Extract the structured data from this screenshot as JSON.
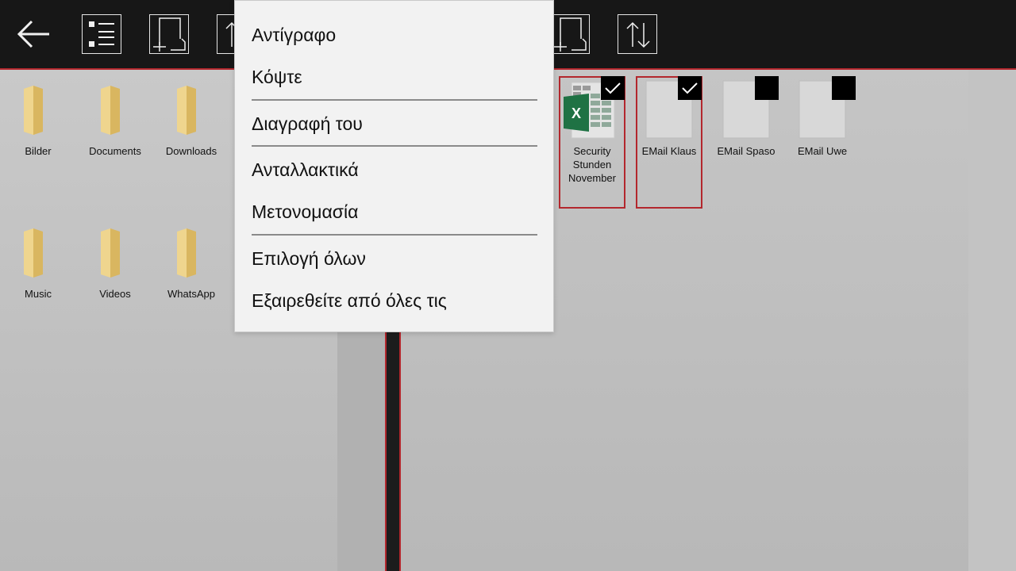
{
  "toolbar": {
    "buttons": [
      {
        "name": "back",
        "icon": "arrow-left-icon"
      },
      {
        "name": "view-list",
        "icon": "list-view-icon"
      },
      {
        "name": "new-item",
        "icon": "new-document-icon"
      },
      {
        "name": "sort-left",
        "icon": "sort-arrows-icon"
      },
      {
        "name": "new-item-right",
        "icon": "new-document-icon"
      },
      {
        "name": "sort-right",
        "icon": "sort-arrows-icon"
      }
    ],
    "accent_color": "#b3272d"
  },
  "left_pane": {
    "items": [
      {
        "label": "Bilder",
        "type": "folder"
      },
      {
        "label": "Documents",
        "type": "folder"
      },
      {
        "label": "Downloads",
        "type": "folder"
      },
      {
        "label": "Music",
        "type": "folder"
      },
      {
        "label": "Videos",
        "type": "folder"
      },
      {
        "label": "WhatsApp",
        "type": "folder"
      }
    ]
  },
  "right_pane": {
    "items": [
      {
        "label": "Security Stunden November",
        "type": "excel-file",
        "selected": true
      },
      {
        "label": "EMail Klaus",
        "type": "file",
        "selected": true
      },
      {
        "label": "EMail Spaso",
        "type": "file",
        "selected": false
      },
      {
        "label": "EMail Uwe",
        "type": "file",
        "selected": false
      }
    ]
  },
  "context_menu": {
    "items": [
      {
        "label": "Αντίγραφο"
      },
      {
        "label": "Κόψτε"
      },
      {
        "label": "Διαγραφή του"
      },
      {
        "label": "Ανταλλακτικά"
      },
      {
        "label": "Μετονομασία"
      },
      {
        "label": "Επιλογή όλων"
      },
      {
        "label": "Εξαιρεθείτε από όλες τις"
      }
    ]
  }
}
